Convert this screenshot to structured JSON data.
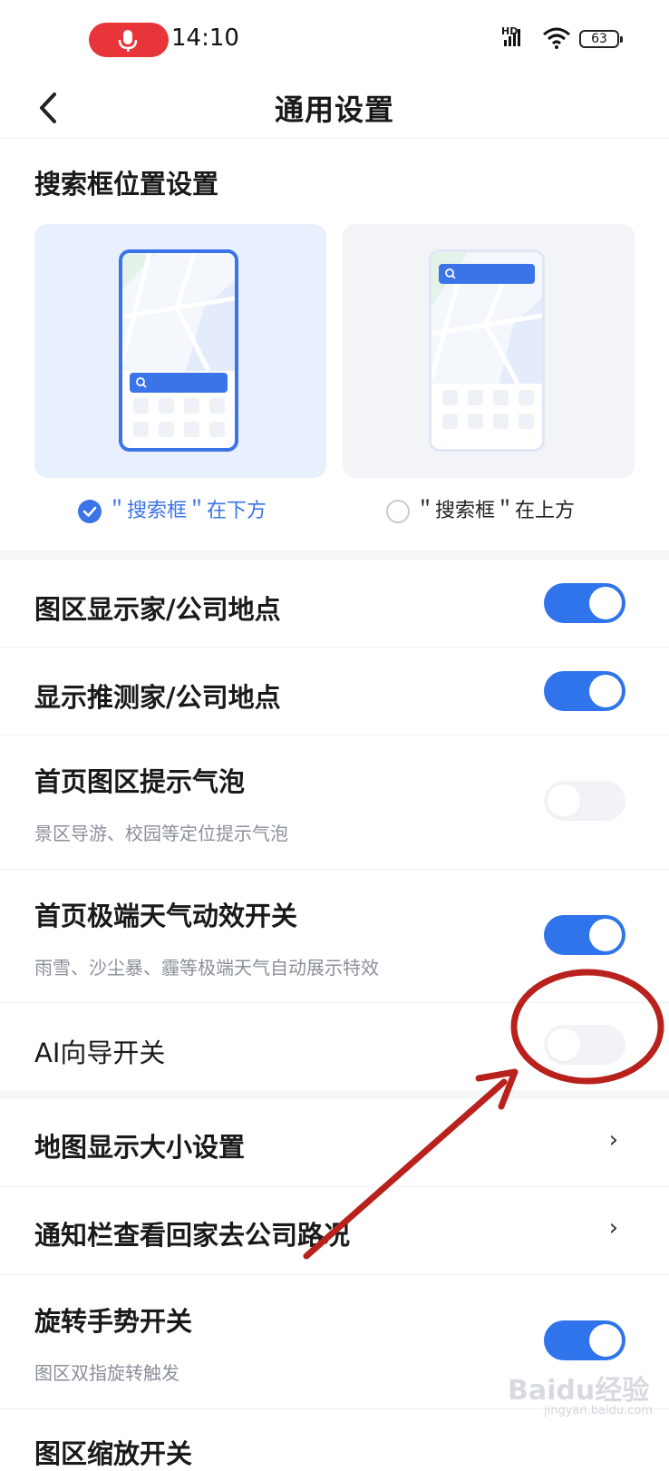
{
  "status_bar": {
    "time": "14:10",
    "network": "HD",
    "battery": "63"
  },
  "nav": {
    "title": "通用设置"
  },
  "search_position": {
    "title": "搜索框位置设置",
    "options": [
      {
        "label": "＂搜索框＂在下方",
        "selected": true
      },
      {
        "label": "＂搜索框＂在上方",
        "selected": false
      }
    ]
  },
  "settings": [
    {
      "label": "图区显示家/公司地点",
      "enabled": true
    },
    {
      "label": "显示推测家/公司地点",
      "enabled": true
    },
    {
      "label": "首页图区提示气泡",
      "sub": "景区导游、校园等定位提示气泡",
      "enabled": false
    },
    {
      "label": "首页极端天气动效开关",
      "sub": "雨雪、沙尘暴、霾等极端天气自动展示特效",
      "enabled": true
    },
    {
      "label": "AI向导开关",
      "enabled": false
    }
  ],
  "links": [
    {
      "label": "地图显示大小设置",
      "chevron": "›"
    },
    {
      "label": "通知栏查看回家去公司路况",
      "chevron": "›"
    }
  ],
  "more_settings": [
    {
      "label": "旋转手势开关",
      "sub": "图区双指旋转触发",
      "enabled": true
    },
    {
      "label": "图区缩放开关"
    }
  ],
  "watermark": {
    "brand": "Baidu经验",
    "url": "jingyan.baidu.com"
  },
  "colors": {
    "accent": "#2f74ea",
    "annotation": "#b8211c"
  }
}
